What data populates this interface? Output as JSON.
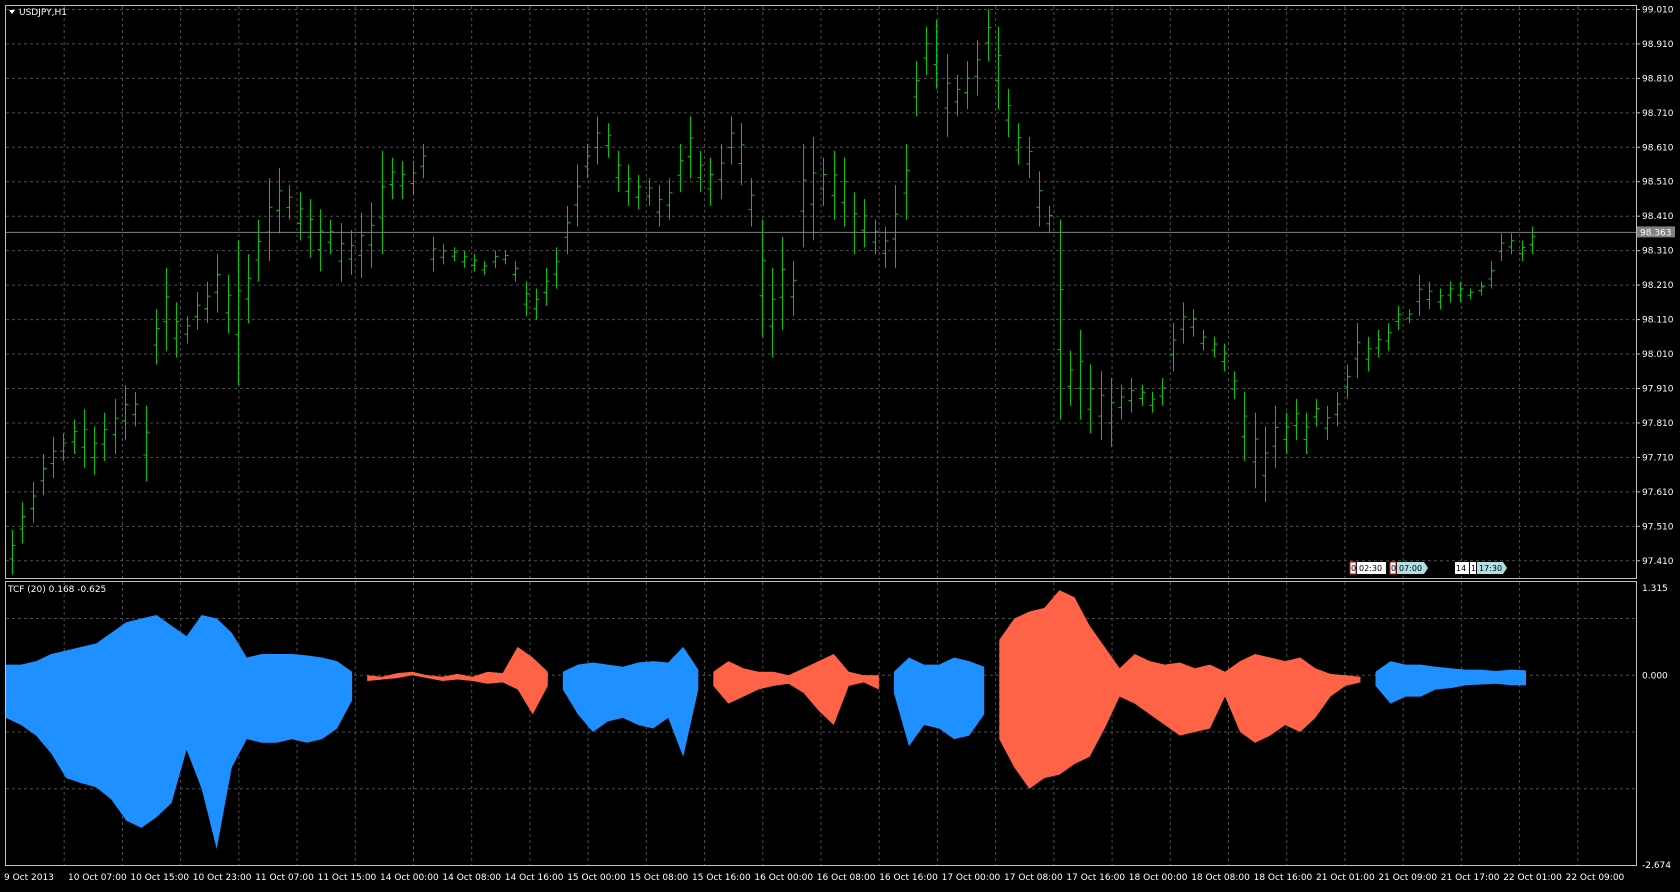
{
  "window": {
    "symbol_title": "USDJPY,H1",
    "indicator_title": "TCF (20) 0.168 -0.625"
  },
  "colors": {
    "background": "#000000",
    "grid": "#4d4d4d",
    "bar": "#00c800",
    "bid_line": "#808080",
    "tcf_positive": "#1e90ff",
    "tcf_negative": "#ff6347",
    "border": "#c0c0c0"
  },
  "price_axis": {
    "labels": [
      "99.010",
      "98.910",
      "98.810",
      "98.710",
      "98.610",
      "98.510",
      "98.410",
      "98.310",
      "98.210",
      "98.110",
      "98.010",
      "97.910",
      "97.810",
      "97.710",
      "97.610",
      "97.510",
      "97.410"
    ],
    "current_price": "98.363"
  },
  "indicator_axis": {
    "labels": [
      "1.315",
      "0.000",
      "-2.674"
    ]
  },
  "time_axis": {
    "labels": [
      "9 Oct 2013",
      "10 Oct 07:00",
      "10 Oct 15:00",
      "10 Oct 23:00",
      "11 Oct 07:00",
      "11 Oct 15:00",
      "14 Oct 00:00",
      "14 Oct 08:00",
      "14 Oct 16:00",
      "15 Oct 00:00",
      "15 Oct 08:00",
      "15 Oct 16:00",
      "16 Oct 00:00",
      "16 Oct 08:00",
      "16 Oct 16:00",
      "17 Oct 00:00",
      "17 Oct 08:00",
      "17 Oct 16:00",
      "18 Oct 00:00",
      "18 Oct 08:00",
      "18 Oct 16:00",
      "21 Oct 01:00",
      "21 Oct 09:00",
      "21 Oct 17:00",
      "22 Oct 01:00",
      "22 Oct 09:00"
    ]
  },
  "session_tags": [
    {
      "a": "0",
      "b": "02:30"
    },
    {
      "a": "0",
      "b": "07:00"
    },
    {
      "a": "14",
      "b": "1",
      "c": "17:30"
    }
  ],
  "chart_data": {
    "type": "bar",
    "title": "USDJPY,H1",
    "ylim": [
      97.36,
      99.02
    ],
    "hl": [
      [
        97.37,
        97.5
      ],
      [
        97.46,
        97.58
      ],
      [
        97.52,
        97.64
      ],
      [
        97.6,
        97.72
      ],
      [
        97.65,
        97.77
      ],
      [
        97.7,
        97.78
      ],
      [
        97.72,
        97.82
      ],
      [
        97.68,
        97.85
      ],
      [
        97.66,
        97.8
      ],
      [
        97.7,
        97.84
      ],
      [
        97.72,
        97.88
      ],
      [
        97.76,
        97.92
      ],
      [
        97.8,
        97.9
      ],
      [
        97.64,
        97.86
      ],
      [
        97.98,
        98.14
      ],
      [
        98.02,
        98.26
      ],
      [
        98.0,
        98.16
      ],
      [
        98.04,
        98.12
      ],
      [
        98.08,
        98.19
      ],
      [
        98.1,
        98.22
      ],
      [
        98.13,
        98.3
      ],
      [
        98.07,
        98.24
      ],
      [
        97.92,
        98.34
      ],
      [
        98.1,
        98.3
      ],
      [
        98.22,
        98.4
      ],
      [
        98.28,
        98.52
      ],
      [
        98.36,
        98.55
      ],
      [
        98.4,
        98.5
      ],
      [
        98.34,
        98.48
      ],
      [
        98.29,
        98.46
      ],
      [
        98.25,
        98.43
      ],
      [
        98.3,
        98.4
      ],
      [
        98.22,
        98.39
      ],
      [
        98.24,
        98.37
      ],
      [
        98.23,
        98.42
      ],
      [
        98.26,
        98.45
      ],
      [
        98.3,
        98.6
      ],
      [
        98.46,
        98.58
      ],
      [
        98.46,
        98.57
      ],
      [
        98.47,
        98.57
      ],
      [
        98.52,
        98.62
      ],
      [
        98.25,
        98.35
      ],
      [
        98.27,
        98.33
      ],
      [
        98.28,
        98.32
      ],
      [
        98.26,
        98.31
      ],
      [
        98.25,
        98.3
      ],
      [
        98.24,
        98.28
      ],
      [
        98.26,
        98.31
      ],
      [
        98.27,
        98.31
      ],
      [
        98.22,
        98.28
      ],
      [
        98.12,
        98.22
      ],
      [
        98.11,
        98.2
      ],
      [
        98.15,
        98.26
      ],
      [
        98.2,
        98.32
      ],
      [
        98.3,
        98.44
      ],
      [
        98.38,
        98.56
      ],
      [
        98.52,
        98.62
      ],
      [
        98.56,
        98.7
      ],
      [
        98.58,
        98.68
      ],
      [
        98.48,
        98.6
      ],
      [
        98.44,
        98.56
      ],
      [
        98.43,
        98.53
      ],
      [
        98.44,
        98.52
      ],
      [
        98.38,
        98.5
      ],
      [
        98.4,
        98.52
      ],
      [
        98.48,
        98.62
      ],
      [
        98.52,
        98.7
      ],
      [
        98.48,
        98.6
      ],
      [
        98.44,
        98.58
      ],
      [
        98.46,
        98.62
      ],
      [
        98.56,
        98.7
      ],
      [
        98.5,
        98.68
      ],
      [
        98.38,
        98.52
      ],
      [
        98.06,
        98.4
      ],
      [
        98.0,
        98.26
      ],
      [
        98.08,
        98.35
      ],
      [
        98.12,
        98.28
      ],
      [
        98.32,
        98.62
      ],
      [
        98.34,
        98.64
      ],
      [
        98.44,
        98.58
      ],
      [
        98.4,
        98.6
      ],
      [
        98.38,
        98.58
      ],
      [
        98.3,
        98.48
      ],
      [
        98.32,
        98.46
      ],
      [
        98.3,
        98.4
      ],
      [
        98.26,
        98.38
      ],
      [
        98.26,
        98.5
      ],
      [
        98.4,
        98.62
      ],
      [
        98.7,
        98.86
      ],
      [
        98.82,
        98.96
      ],
      [
        98.78,
        98.98
      ],
      [
        98.64,
        98.88
      ],
      [
        98.7,
        98.82
      ],
      [
        98.72,
        98.86
      ],
      [
        98.76,
        98.92
      ],
      [
        98.86,
        99.01
      ],
      [
        98.72,
        98.96
      ],
      [
        98.64,
        98.78
      ],
      [
        98.56,
        98.68
      ],
      [
        98.52,
        98.64
      ],
      [
        98.38,
        98.54
      ],
      [
        98.36,
        98.44
      ],
      [
        97.82,
        98.4
      ],
      [
        97.86,
        98.02
      ],
      [
        97.82,
        98.08
      ],
      [
        97.78,
        97.98
      ],
      [
        97.76,
        97.96
      ],
      [
        97.74,
        97.94
      ],
      [
        97.82,
        97.92
      ],
      [
        97.84,
        97.94
      ],
      [
        97.86,
        97.92
      ],
      [
        97.84,
        97.9
      ],
      [
        97.86,
        97.94
      ],
      [
        97.96,
        98.1
      ],
      [
        98.04,
        98.16
      ],
      [
        98.06,
        98.14
      ],
      [
        98.02,
        98.08
      ],
      [
        98.0,
        98.06
      ],
      [
        97.96,
        98.04
      ],
      [
        97.88,
        97.96
      ],
      [
        97.7,
        97.9
      ],
      [
        97.62,
        97.84
      ],
      [
        97.58,
        97.8
      ],
      [
        97.68,
        97.86
      ],
      [
        97.72,
        97.84
      ],
      [
        97.76,
        97.88
      ],
      [
        97.72,
        97.84
      ],
      [
        97.8,
        97.88
      ],
      [
        97.76,
        97.86
      ],
      [
        97.8,
        97.9
      ],
      [
        97.88,
        97.98
      ],
      [
        97.94,
        98.1
      ],
      [
        97.96,
        98.06
      ],
      [
        98.0,
        98.08
      ],
      [
        98.02,
        98.1
      ],
      [
        98.08,
        98.15
      ],
      [
        98.1,
        98.14
      ],
      [
        98.12,
        98.24
      ],
      [
        98.14,
        98.22
      ],
      [
        98.14,
        98.2
      ],
      [
        98.16,
        98.22
      ],
      [
        98.16,
        98.22
      ],
      [
        98.17,
        98.2
      ],
      [
        98.18,
        98.22
      ],
      [
        98.2,
        98.28
      ],
      [
        98.28,
        98.36
      ],
      [
        98.3,
        98.36
      ],
      [
        98.28,
        98.34
      ],
      [
        98.3,
        98.38
      ]
    ],
    "tcf_positive": [
      [
        0.15,
        -0.6
      ],
      [
        0.15,
        -0.7
      ],
      [
        0.2,
        -0.85
      ],
      [
        0.3,
        -1.1
      ],
      [
        0.35,
        -1.45
      ],
      [
        0.4,
        -1.52
      ],
      [
        0.45,
        -1.58
      ],
      [
        0.6,
        -1.75
      ],
      [
        0.75,
        -2.05
      ],
      [
        0.8,
        -2.15
      ],
      [
        0.85,
        -2.0
      ],
      [
        0.7,
        -1.8
      ],
      [
        0.55,
        -1.05
      ],
      [
        0.85,
        -1.6
      ],
      [
        0.8,
        -2.45
      ],
      [
        0.6,
        -1.3
      ],
      [
        0.25,
        -0.9
      ],
      [
        0.3,
        -0.95
      ],
      [
        0.3,
        -0.95
      ],
      [
        0.3,
        -0.9
      ],
      [
        0.28,
        -0.95
      ],
      [
        0.25,
        -0.9
      ],
      [
        0.2,
        -0.75
      ],
      [
        0.05,
        -0.35
      ],
      null,
      null,
      null,
      null,
      null,
      null,
      null,
      null,
      null,
      null,
      null,
      null,
      null,
      [
        0.05,
        -0.2
      ],
      [
        0.15,
        -0.55
      ],
      [
        0.18,
        -0.8
      ],
      [
        0.15,
        -0.65
      ],
      [
        0.12,
        -0.6
      ],
      [
        0.18,
        -0.7
      ],
      [
        0.2,
        -0.75
      ],
      [
        0.18,
        -0.6
      ],
      [
        0.4,
        -1.15
      ],
      [
        0.08,
        -0.2
      ],
      null,
      null,
      null,
      null,
      null,
      null,
      null,
      null,
      null,
      null,
      null,
      null,
      [
        0.05,
        -0.25
      ],
      [
        0.25,
        -1.0
      ],
      [
        0.15,
        -0.7
      ],
      [
        0.15,
        -0.75
      ],
      [
        0.25,
        -0.9
      ],
      [
        0.2,
        -0.85
      ],
      [
        0.12,
        -0.55
      ],
      null,
      null,
      null,
      null,
      null,
      null,
      null,
      null,
      null,
      null,
      null,
      null,
      null,
      null,
      null,
      null,
      null,
      null,
      null,
      null,
      null,
      null,
      null,
      null,
      null,
      [
        0.05,
        -0.15
      ],
      [
        0.2,
        -0.4
      ],
      [
        0.15,
        -0.3
      ],
      [
        0.15,
        -0.3
      ],
      [
        0.12,
        -0.2
      ],
      [
        0.1,
        -0.18
      ],
      [
        0.08,
        -0.14
      ],
      [
        0.08,
        -0.13
      ],
      [
        0.06,
        -0.12
      ],
      [
        0.08,
        -0.14
      ],
      [
        0.07,
        -0.14
      ]
    ],
    "tcf_negative": [
      null,
      null,
      null,
      null,
      null,
      null,
      null,
      null,
      null,
      null,
      null,
      null,
      null,
      null,
      null,
      null,
      null,
      null,
      null,
      null,
      null,
      null,
      null,
      null,
      [
        0.0,
        -0.08
      ],
      [
        -0.02,
        -0.06
      ],
      [
        0.03,
        -0.04
      ],
      [
        0.05,
        0.0
      ],
      [
        0.0,
        -0.04
      ],
      [
        -0.02,
        -0.08
      ],
      [
        0.02,
        -0.06
      ],
      [
        -0.02,
        -0.08
      ],
      [
        0.05,
        -0.12
      ],
      [
        0.03,
        -0.1
      ],
      [
        0.4,
        -0.2
      ],
      [
        0.25,
        -0.55
      ],
      [
        0.05,
        -0.15
      ],
      null,
      null,
      null,
      null,
      null,
      null,
      null,
      null,
      null,
      null,
      [
        0.05,
        -0.15
      ],
      [
        0.2,
        -0.4
      ],
      [
        0.1,
        -0.3
      ],
      [
        0.05,
        -0.2
      ],
      [
        0.05,
        -0.15
      ],
      [
        0.0,
        -0.12
      ],
      [
        0.1,
        -0.25
      ],
      [
        0.2,
        -0.5
      ],
      [
        0.3,
        -0.7
      ],
      [
        0.05,
        -0.15
      ],
      [
        0.0,
        -0.1
      ],
      [
        0.0,
        -0.2
      ],
      null,
      null,
      null,
      null,
      null,
      null,
      null,
      [
        0.5,
        -0.9
      ],
      [
        0.8,
        -1.3
      ],
      [
        0.9,
        -1.6
      ],
      [
        0.95,
        -1.45
      ],
      [
        1.2,
        -1.4
      ],
      [
        1.1,
        -1.25
      ],
      [
        0.7,
        -1.15
      ],
      [
        0.4,
        -0.75
      ],
      [
        0.1,
        -0.3
      ],
      [
        0.3,
        -0.4
      ],
      [
        0.2,
        -0.55
      ],
      [
        0.15,
        -0.7
      ],
      [
        0.18,
        -0.85
      ],
      [
        0.1,
        -0.8
      ],
      [
        0.15,
        -0.75
      ],
      [
        0.05,
        -0.3
      ],
      [
        0.2,
        -0.8
      ],
      [
        0.3,
        -0.95
      ],
      [
        0.25,
        -0.85
      ],
      [
        0.2,
        -0.7
      ],
      [
        0.25,
        -0.8
      ],
      [
        0.1,
        -0.6
      ],
      [
        0.02,
        -0.3
      ],
      [
        0.0,
        -0.15
      ],
      [
        -0.02,
        -0.1
      ],
      null,
      null,
      null,
      null,
      null,
      null,
      null,
      null,
      null,
      null,
      null
    ]
  }
}
